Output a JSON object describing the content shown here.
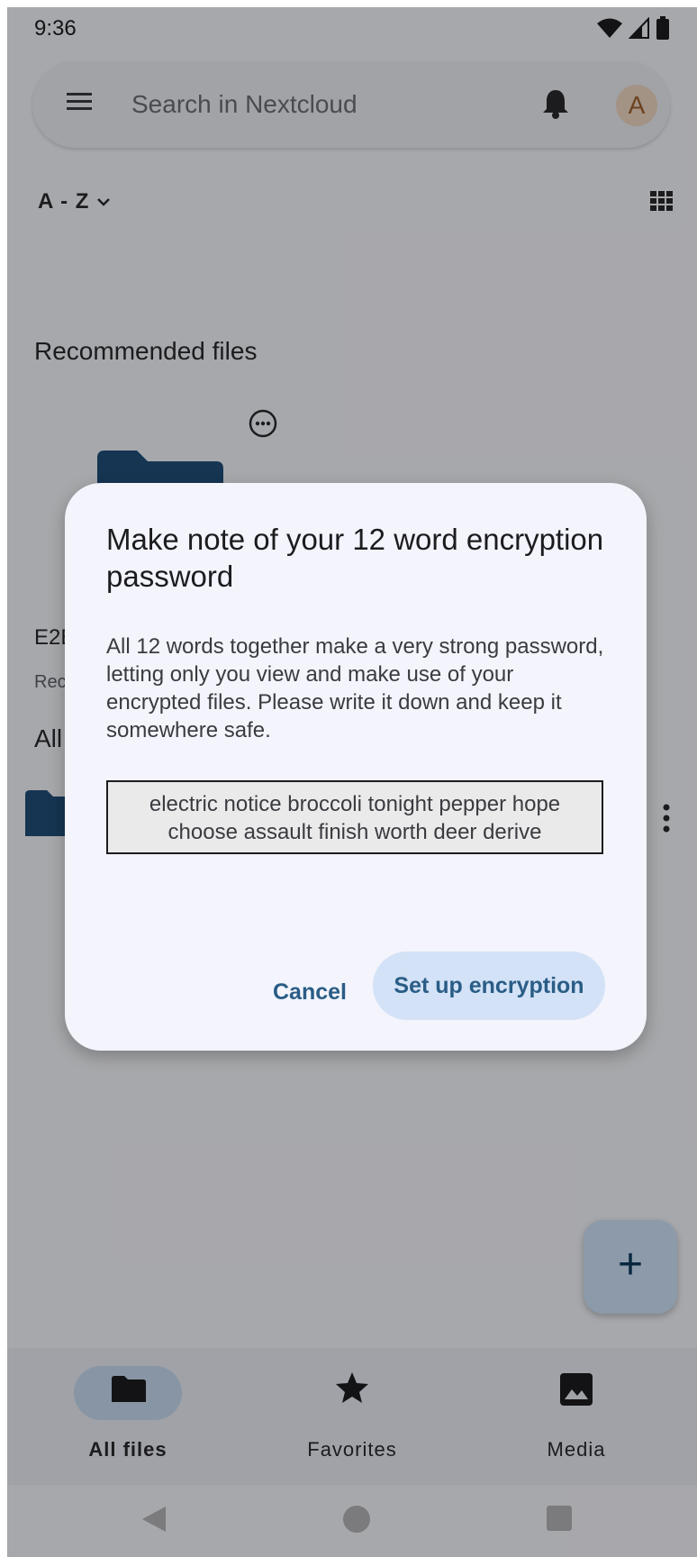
{
  "status_bar": {
    "time": "9:36"
  },
  "search": {
    "placeholder": "Search in Nextcloud",
    "avatar_initial": "A"
  },
  "sort": {
    "label": "A - Z"
  },
  "recommended": {
    "title": "Recommended files",
    "file_name": "E2E",
    "file_sub": "Rec"
  },
  "all_files": {
    "title": "All"
  },
  "dialog": {
    "title": "Make note of your 12 word encryption password",
    "body": "All 12 words together make a very strong password, letting only you view and make use of your encrypted files. Please write it down and keep it somewhere safe.",
    "password_line1": "electric notice broccoli tonight pepper hope",
    "password_line2": "choose assault finish worth deer derive",
    "cancel_label": "Cancel",
    "confirm_label": "Set up encryption"
  },
  "fab": {
    "label": "+"
  },
  "bottom_nav": {
    "items": [
      {
        "label": "All files",
        "icon": "folder-icon",
        "active": true
      },
      {
        "label": "Favorites",
        "icon": "star-icon",
        "active": false
      },
      {
        "label": "Media",
        "icon": "image-icon",
        "active": false
      }
    ]
  },
  "colors": {
    "accent": "#2a5d86",
    "folder": "#1f4e7a",
    "scrim": "rgba(0,0,0,0.32)"
  }
}
